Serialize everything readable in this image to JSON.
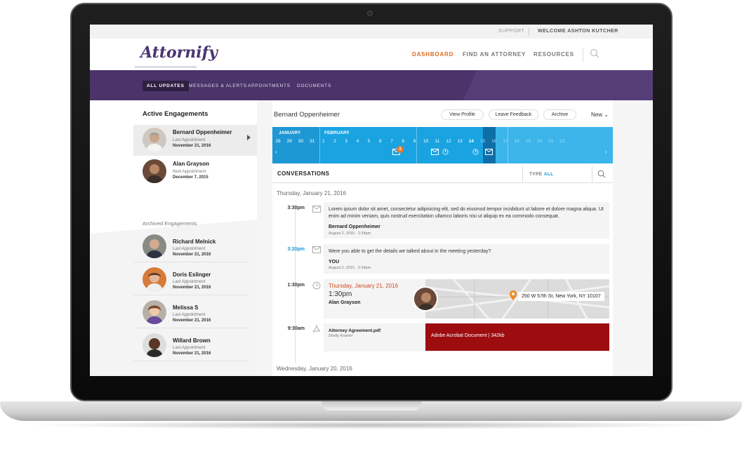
{
  "util": {
    "support": "SUPPORT",
    "welcome_prefix": "WELCOME ",
    "welcome_name": "ASHTON KUTCHER"
  },
  "header": {
    "logo": "Attornify",
    "nav": [
      "DASHBOARD",
      "FIND AN ATTORNEY",
      "RESOURCES"
    ],
    "active": "DASHBOARD"
  },
  "tabs": [
    "ALL UPDATES",
    "MESSAGES & ALERTS",
    "APPOINTMENTS",
    "DOCUMENTS"
  ],
  "sidebar": {
    "active_title": "Active Engagements",
    "active": [
      {
        "name": "Bernard Oppenheimer",
        "label": "Last Appointment",
        "date": "November 21, 2016"
      },
      {
        "name": "Alan Grayson",
        "label": "Next Appointment",
        "date": "December 7, 2015"
      }
    ],
    "archived_title": "Archived Engagements",
    "archived": [
      {
        "name": "Richard Melnick",
        "label": "Last Appointment",
        "date": "November 21, 2016"
      },
      {
        "name": "Doris Eslinger",
        "label": "Last Appointment",
        "date": "November 21, 2016"
      },
      {
        "name": "Melissa S",
        "label": "Last Appointment",
        "date": "November 21, 2016"
      },
      {
        "name": "Willard Brown",
        "label": "Last Appointment",
        "date": "November 21, 2016"
      }
    ]
  },
  "main": {
    "client": "Bernard Oppenheimer",
    "buttons": {
      "view_profile": "View Profile",
      "leave_feedback": "Leave Feedback",
      "archive": "Archive",
      "new": "New"
    },
    "calendar": {
      "months": [
        "JANUARY",
        "FEBRUARY"
      ],
      "jan_days": [
        "28",
        "29",
        "30",
        "31"
      ],
      "feb_days": [
        "1",
        "2",
        "3",
        "4",
        "5",
        "6",
        "7",
        "8",
        "9",
        "10",
        "11",
        "12",
        "13",
        "14",
        "15",
        "16",
        "17",
        "18",
        "19",
        "20",
        "21",
        "22"
      ],
      "selected": "14",
      "badge": "3"
    },
    "conversations": {
      "title": "CONVERSATIONS",
      "type_label": "TYPE ",
      "type_value": "ALL",
      "date1": "Thursday, January 21, 2016",
      "date2": "Wednesday, January 20, 2016",
      "items": [
        {
          "time": "3:30pm",
          "text": "Lorem ipsum dolor sit amet, consectetur adipisicing elit, sed do eiusmod tempor incididunt ut labore et dolore magna aliqua. Ut enim ad minim veniam, quis nostrud exercitation ullamco laboris nisi ut aliquip ex ea commodo consequat.",
          "who": "Bernard Oppenheimer",
          "when": "August 2, 2015 · 2:34pm"
        },
        {
          "time": "3:20pm",
          "text": "Were you able to get the details we talked about in the meeting yesterday?",
          "who": "YOU",
          "when": "August 2, 2015 · 2:34pm"
        }
      ],
      "appointment": {
        "time": "1:30pm",
        "date": "Thursday, January 21, 2016",
        "hour": "1:30pm",
        "who": "Alan Grayson",
        "address": "250 W 57th St, New York, NY 10107"
      },
      "document": {
        "time": "9:30am",
        "name": "Attorney Agreement.pdf",
        "by": "Shelly Kramer",
        "type": "Adobe Acrobat Document  |  342kb"
      }
    }
  },
  "colors": {
    "purple": "#4b3469",
    "accent": "#e06a1b",
    "calendar": "#1aa3e1",
    "doc": "#9d0d10"
  }
}
